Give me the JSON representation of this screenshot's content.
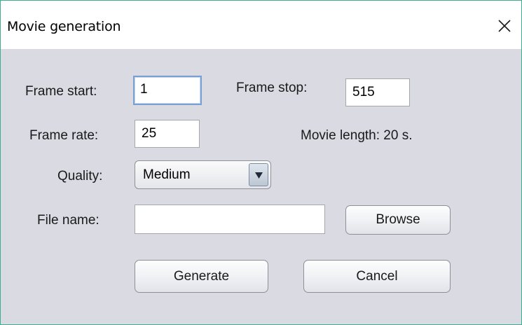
{
  "window": {
    "title": "Movie generation",
    "close_icon": "close-icon"
  },
  "form": {
    "frame_start_label": "Frame start:",
    "frame_start_value": "1",
    "frame_stop_label": "Frame stop:",
    "frame_stop_value": "515",
    "frame_rate_label": "Frame rate:",
    "frame_rate_value": "25",
    "movie_length_text": "Movie length: 20 s.",
    "quality_label": "Quality:",
    "quality_selected": "Medium",
    "file_name_label": "File name:",
    "file_name_value": ""
  },
  "buttons": {
    "browse": "Browse",
    "generate": "Generate",
    "cancel": "Cancel"
  },
  "colors": {
    "window_border": "#3fae8e",
    "panel_background": "#d9dae2",
    "focus_border": "#7a9fd1"
  }
}
